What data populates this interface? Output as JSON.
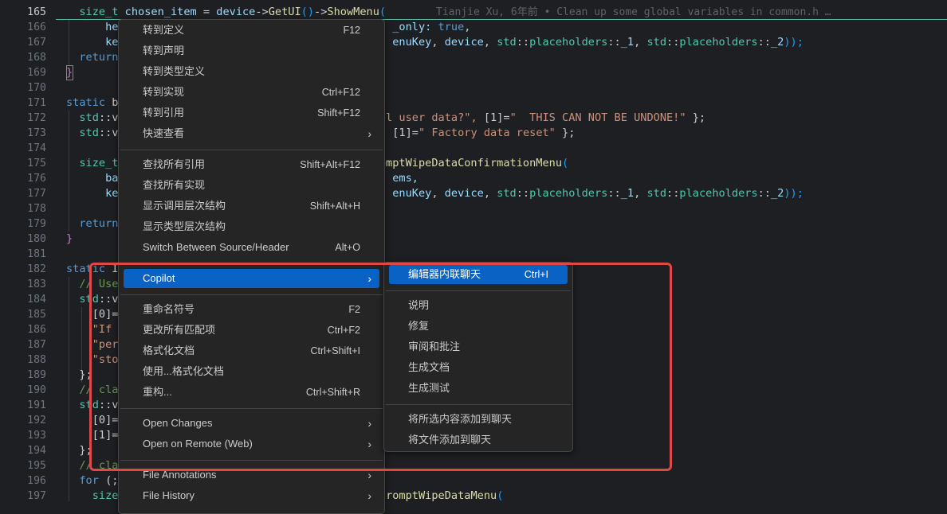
{
  "editor": {
    "lines": [
      {
        "n": "165",
        "active": true,
        "parts": [
          [
            "  ",
            ""
          ],
          [
            "size_t",
            "ty"
          ],
          [
            " ",
            ""
          ],
          [
            "chosen_item",
            "var"
          ],
          [
            " = ",
            ""
          ],
          [
            "device",
            "var"
          ],
          [
            "->",
            "pun"
          ],
          [
            "GetUI",
            "fn"
          ],
          [
            "()",
            "brk2"
          ],
          [
            "->",
            "pun"
          ],
          [
            "ShowMenu",
            "fn"
          ],
          [
            "(",
            "brk2"
          ]
        ]
      },
      {
        "n": "166",
        "parts": [
          [
            "      he",
            "var"
          ],
          [
            "                                          ",
            ""
          ],
          [
            "_only: ",
            "var"
          ],
          [
            "true",
            "kw"
          ],
          [
            ",",
            ""
          ]
        ]
      },
      {
        "n": "167",
        "parts": [
          [
            "      ke",
            "var"
          ],
          [
            "                                          ",
            ""
          ],
          [
            "enuKey",
            "var"
          ],
          [
            ", ",
            ""
          ],
          [
            "device",
            "var"
          ],
          [
            ", ",
            ""
          ],
          [
            "std",
            "ty"
          ],
          [
            "::",
            ""
          ],
          [
            "placeholders",
            "ty"
          ],
          [
            "::",
            ""
          ],
          [
            "_1",
            "var"
          ],
          [
            ", ",
            ""
          ],
          [
            "std",
            "ty"
          ],
          [
            "::",
            ""
          ],
          [
            "placeholders",
            "ty"
          ],
          [
            "::",
            ""
          ],
          [
            "_2",
            "var"
          ],
          [
            "));",
            "brk2"
          ]
        ]
      },
      {
        "n": "168",
        "parts": [
          [
            "  ",
            ""
          ],
          [
            "return",
            "kw"
          ]
        ]
      },
      {
        "n": "169",
        "parts": [
          [
            "}",
            "brk"
          ]
        ]
      },
      {
        "n": "170",
        "parts": []
      },
      {
        "n": "171",
        "parts": [
          [
            "static",
            "kw"
          ],
          [
            " b",
            ""
          ]
        ]
      },
      {
        "n": "172",
        "parts": [
          [
            "  ",
            ""
          ],
          [
            "std",
            "ty"
          ],
          [
            "::v",
            ""
          ],
          [
            "                                        ",
            ""
          ],
          [
            "ll user data?\", ",
            "str"
          ],
          [
            "[1]=",
            "pun"
          ],
          [
            "\"  THIS CAN NOT BE UNDONE!\"",
            "str"
          ],
          [
            " };",
            ""
          ]
        ]
      },
      {
        "n": "173",
        "parts": [
          [
            "  ",
            ""
          ],
          [
            "std",
            "ty"
          ],
          [
            "::v",
            ""
          ],
          [
            "                                        ",
            ""
          ],
          [
            ", ",
            ""
          ],
          [
            "[1]=",
            "pun"
          ],
          [
            "\" Factory data reset\"",
            "str"
          ],
          [
            " };",
            ""
          ]
        ]
      },
      {
        "n": "174",
        "parts": []
      },
      {
        "n": "175",
        "parts": [
          [
            "  ",
            ""
          ],
          [
            "size_t",
            "ty"
          ],
          [
            "                                       ",
            ""
          ],
          [
            "romptWipeDataConfirmationMenu",
            "fn"
          ],
          [
            "(",
            "brk2"
          ]
        ]
      },
      {
        "n": "176",
        "parts": [
          [
            "      ba",
            "var"
          ],
          [
            "                                          ",
            ""
          ],
          [
            "ems,",
            "var"
          ]
        ]
      },
      {
        "n": "177",
        "parts": [
          [
            "      ke",
            "var"
          ],
          [
            "                                          ",
            ""
          ],
          [
            "enuKey",
            "var"
          ],
          [
            ", ",
            ""
          ],
          [
            "device",
            "var"
          ],
          [
            ", ",
            ""
          ],
          [
            "std",
            "ty"
          ],
          [
            "::",
            ""
          ],
          [
            "placeholders",
            "ty"
          ],
          [
            "::",
            ""
          ],
          [
            "_1",
            "var"
          ],
          [
            ", ",
            ""
          ],
          [
            "std",
            "ty"
          ],
          [
            "::",
            ""
          ],
          [
            "placeholders",
            "ty"
          ],
          [
            "::",
            ""
          ],
          [
            "_2",
            "var"
          ],
          [
            "));",
            "brk2"
          ]
        ]
      },
      {
        "n": "178",
        "parts": []
      },
      {
        "n": "179",
        "parts": [
          [
            "  ",
            ""
          ],
          [
            "return",
            "kw"
          ]
        ]
      },
      {
        "n": "180",
        "parts": [
          [
            "}",
            "brk"
          ]
        ]
      },
      {
        "n": "181",
        "parts": []
      },
      {
        "n": "182",
        "parts": [
          [
            "static",
            "kw"
          ],
          [
            " I",
            ""
          ]
        ]
      },
      {
        "n": "183",
        "parts": [
          [
            "  ",
            ""
          ],
          [
            "// Use",
            "cm"
          ]
        ]
      },
      {
        "n": "184",
        "parts": [
          [
            "  ",
            ""
          ],
          [
            "std",
            "ty"
          ],
          [
            "::v",
            ""
          ]
        ]
      },
      {
        "n": "185",
        "parts": [
          [
            "    ",
            ""
          ],
          [
            "[0]=",
            "pun"
          ]
        ]
      },
      {
        "n": "186",
        "parts": [
          [
            "    ",
            ""
          ],
          [
            "\"If",
            "str"
          ]
        ]
      },
      {
        "n": "187",
        "parts": [
          [
            "    ",
            ""
          ],
          [
            "\"per",
            "str"
          ]
        ]
      },
      {
        "n": "188",
        "parts": [
          [
            "    ",
            ""
          ],
          [
            "\"sto",
            "str"
          ]
        ]
      },
      {
        "n": "189",
        "parts": [
          [
            "  ",
            ""
          ],
          [
            "};",
            ""
          ]
        ]
      },
      {
        "n": "190",
        "parts": [
          [
            "  ",
            ""
          ],
          [
            "// cla",
            "cm"
          ]
        ]
      },
      {
        "n": "191",
        "parts": [
          [
            "  ",
            ""
          ],
          [
            "std",
            "ty"
          ],
          [
            "::v",
            ""
          ]
        ]
      },
      {
        "n": "192",
        "parts": [
          [
            "    ",
            ""
          ],
          [
            "[0]=",
            "pun"
          ]
        ]
      },
      {
        "n": "193",
        "parts": [
          [
            "    ",
            ""
          ],
          [
            "[1]=",
            "pun"
          ]
        ]
      },
      {
        "n": "194",
        "parts": [
          [
            "  ",
            ""
          ],
          [
            "};",
            ""
          ]
        ]
      },
      {
        "n": "195",
        "parts": [
          [
            "  ",
            ""
          ],
          [
            "// cla",
            "cm"
          ]
        ]
      },
      {
        "n": "196",
        "parts": [
          [
            "  ",
            ""
          ],
          [
            "for",
            "kw"
          ],
          [
            " (;",
            ""
          ]
        ]
      },
      {
        "n": "197",
        "parts": [
          [
            "    ",
            ""
          ],
          [
            "size",
            "ty"
          ],
          [
            "                                         ",
            ""
          ],
          [
            "romptWipeDataMenu",
            "fn"
          ],
          [
            "(",
            "brk2"
          ]
        ]
      }
    ],
    "blame": "Tianjie Xu, 6年前 • Clean up some global variables in common.h …"
  },
  "context_menu": {
    "items": [
      {
        "type": "item",
        "label": "转到定义",
        "shortcut": "F12"
      },
      {
        "type": "item",
        "label": "转到声明",
        "shortcut": ""
      },
      {
        "type": "item",
        "label": "转到类型定义",
        "shortcut": ""
      },
      {
        "type": "item",
        "label": "转到实现",
        "shortcut": "Ctrl+F12"
      },
      {
        "type": "item",
        "label": "转到引用",
        "shortcut": "Shift+F12"
      },
      {
        "type": "item",
        "label": "快速查看",
        "shortcut": "",
        "submenu": true
      },
      {
        "type": "sep"
      },
      {
        "type": "item",
        "label": "查找所有引用",
        "shortcut": "Shift+Alt+F12"
      },
      {
        "type": "item",
        "label": "查找所有实现",
        "shortcut": ""
      },
      {
        "type": "item",
        "label": "显示调用层次结构",
        "shortcut": "Shift+Alt+H"
      },
      {
        "type": "item",
        "label": "显示类型层次结构",
        "shortcut": ""
      },
      {
        "type": "item",
        "label": "Switch Between Source/Header",
        "shortcut": "Alt+O"
      },
      {
        "type": "sep"
      },
      {
        "type": "item",
        "label": "Copilot",
        "shortcut": "",
        "submenu": true,
        "highlighted": true
      },
      {
        "type": "sep"
      },
      {
        "type": "item",
        "label": "重命名符号",
        "shortcut": "F2"
      },
      {
        "type": "item",
        "label": "更改所有匹配项",
        "shortcut": "Ctrl+F2"
      },
      {
        "type": "item",
        "label": "格式化文档",
        "shortcut": "Ctrl+Shift+I"
      },
      {
        "type": "item",
        "label": "使用...格式化文档",
        "shortcut": ""
      },
      {
        "type": "item",
        "label": "重构...",
        "shortcut": "Ctrl+Shift+R"
      },
      {
        "type": "sep"
      },
      {
        "type": "item",
        "label": "Open Changes",
        "shortcut": "",
        "submenu": true
      },
      {
        "type": "item",
        "label": "Open on Remote (Web)",
        "shortcut": "",
        "submenu": true
      },
      {
        "type": "sep"
      },
      {
        "type": "item",
        "label": "File Annotations",
        "shortcut": "",
        "submenu": true
      },
      {
        "type": "item",
        "label": "File History",
        "shortcut": "",
        "submenu": true
      }
    ]
  },
  "copilot_submenu": {
    "items": [
      {
        "type": "item",
        "label": "编辑器内联聊天",
        "shortcut": "Ctrl+I",
        "highlighted": true
      },
      {
        "type": "sep"
      },
      {
        "type": "item",
        "label": "说明",
        "shortcut": ""
      },
      {
        "type": "item",
        "label": "修复",
        "shortcut": ""
      },
      {
        "type": "item",
        "label": "审阅和批注",
        "shortcut": ""
      },
      {
        "type": "item",
        "label": "生成文档",
        "shortcut": ""
      },
      {
        "type": "item",
        "label": "生成测试",
        "shortcut": ""
      },
      {
        "type": "sep"
      },
      {
        "type": "item",
        "label": "将所选内容添加到聊天",
        "shortcut": ""
      },
      {
        "type": "item",
        "label": "将文件添加到聊天",
        "shortcut": ""
      }
    ]
  },
  "colors": {
    "highlight": "#0a63c4",
    "annotation_box": "#e04848",
    "menu_bg": "#252526"
  },
  "icons": {
    "submenu": "chevron-right-icon"
  }
}
